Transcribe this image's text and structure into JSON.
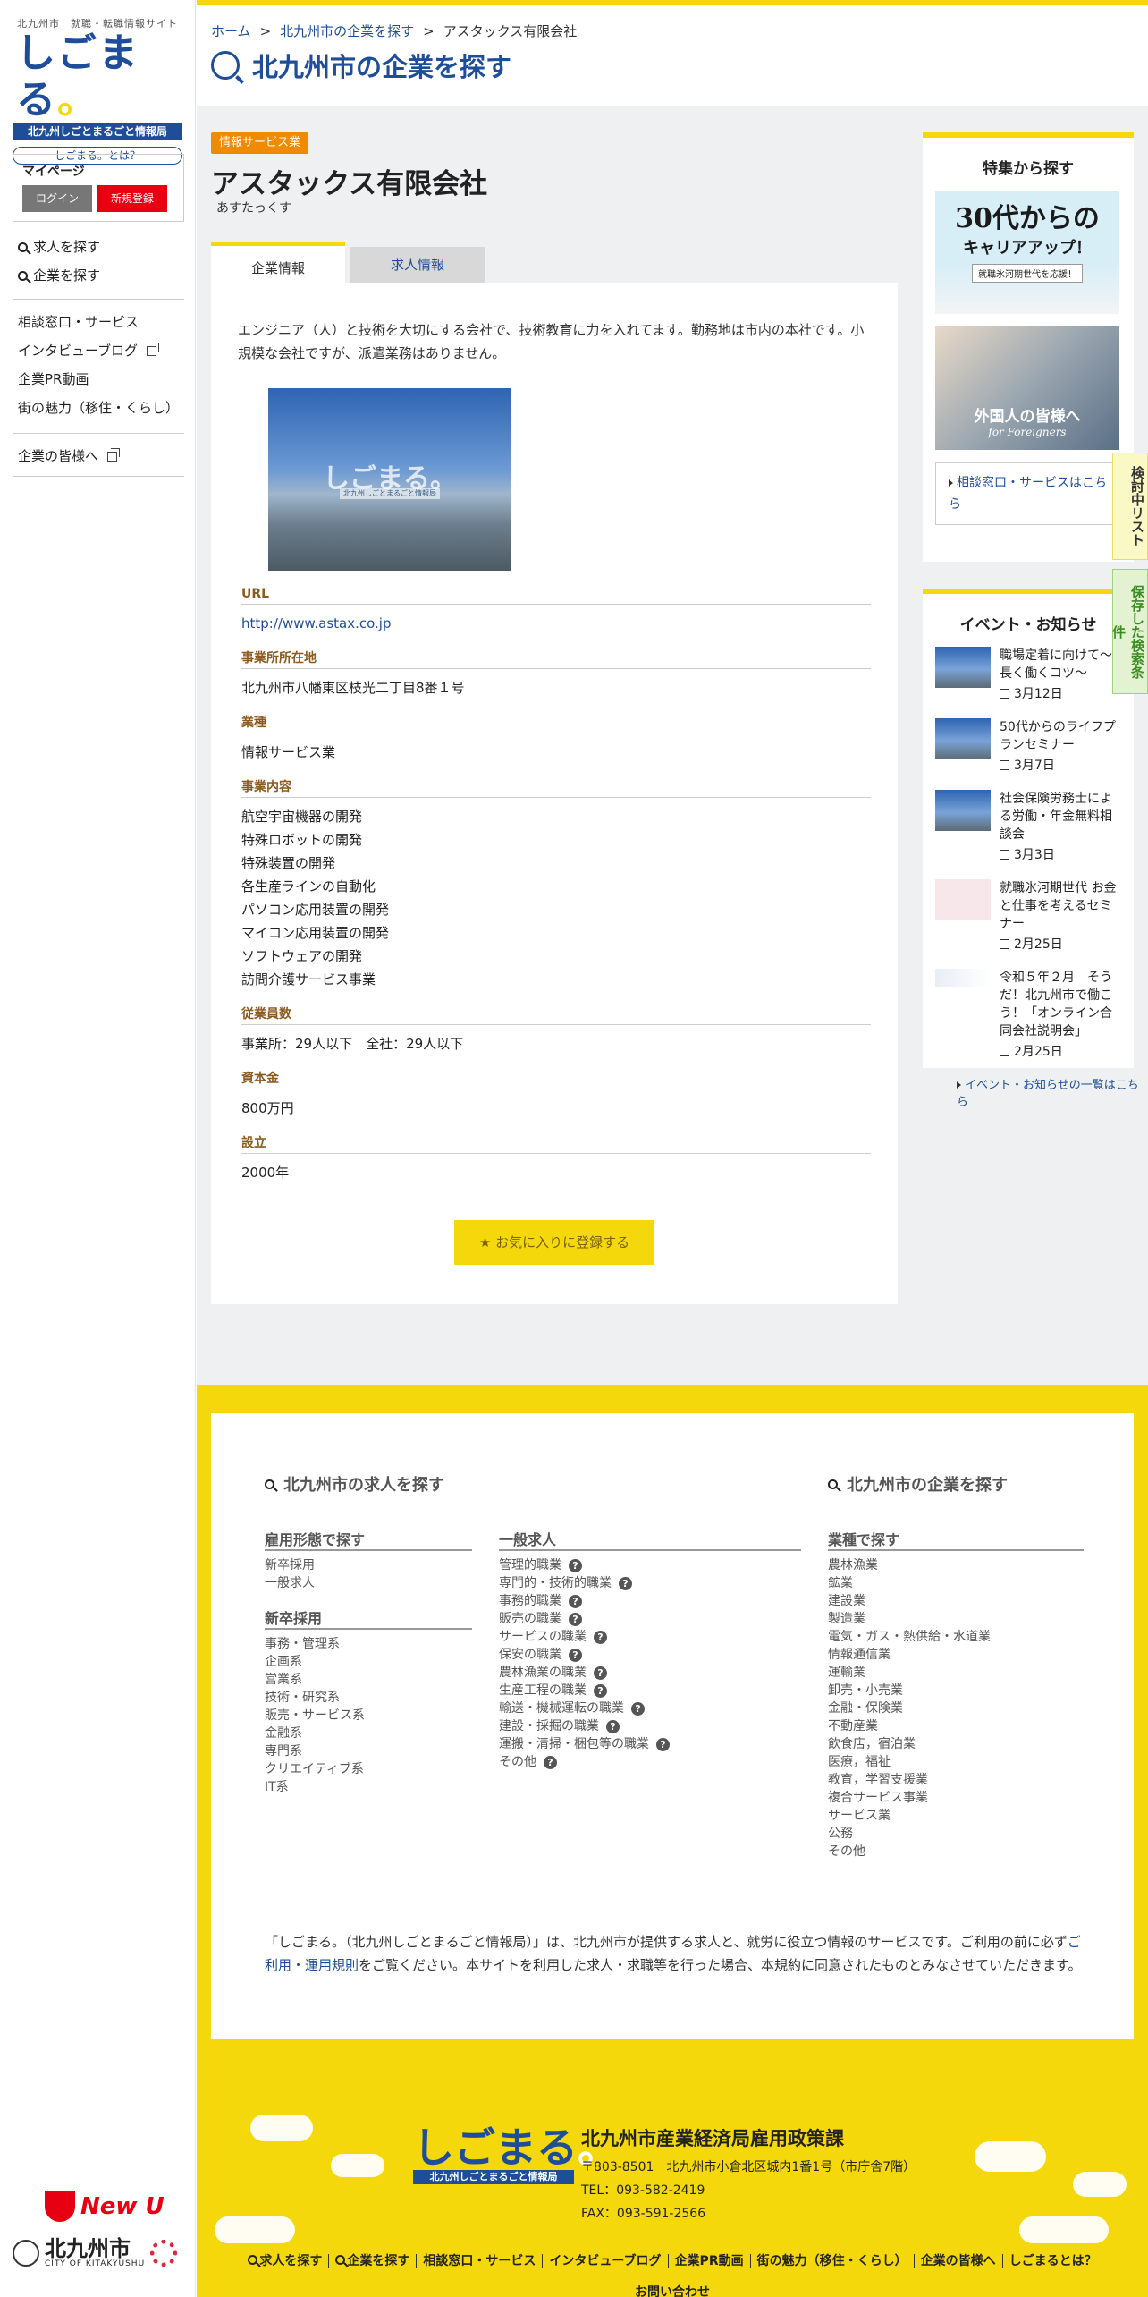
{
  "site": {
    "tagline": "北九州市　就職・転職情報サイト",
    "logo_text": "しごまる",
    "logo_band": "北九州しごとまるごと情報局",
    "what_link": "しごまる。とは？"
  },
  "mypage": {
    "title": "マイページ",
    "login": "ログイン",
    "register": "新規登録"
  },
  "sidebar": {
    "search_items": [
      "求人を探す",
      "企業を探す"
    ],
    "info_items": [
      "相談窓口・サービス",
      "インタビューブログ",
      "企業PR動画",
      "街の魅力（移住・くらし）"
    ],
    "corporate": "企業の皆様へ",
    "newu": "New U",
    "city_name": "北九州市",
    "city_sub": "CITY OF KITAKYUSHU"
  },
  "breadcrumb": {
    "home": "ホーム",
    "search": "北九州市の企業を探す",
    "current": "アスタックス有限会社"
  },
  "page_title": "北九州市の企業を探す",
  "company": {
    "category": "情報サービス業",
    "name": "アスタックス有限会社",
    "kana": "あすたっくす",
    "tabs": [
      "企業情報",
      "求人情報"
    ],
    "intro": "エンジニア（人）と技術を大切にする会社で、技術教育に力を入れてます。勤務地は市内の本社です。小規模な会社ですが、派遣業務はありません。",
    "photo_watermark": "しごまる。",
    "photo_watermark_sub": "北九州しごとまるごと情報局",
    "fields": {
      "url_label": "URL",
      "url": "http://www.astax.co.jp",
      "address_label": "事業所所在地",
      "address": "北九州市八幡東区枝光二丁目8番１号",
      "industry_label": "業種",
      "industry": "情報サービス業",
      "business_label": "事業内容",
      "business": [
        "航空宇宙機器の開発",
        "特殊ロボットの開発",
        "特殊装置の開発",
        "各生産ラインの自動化",
        "パソコン応用装置の開発",
        "マイコン応用装置の開発",
        "ソフトウェアの開発",
        "訪問介護サービス事業"
      ],
      "employees_label": "従業員数",
      "employees": "事業所：29人以下　全社：29人以下",
      "capital_label": "資本金",
      "capital": "800万円",
      "founded_label": "設立",
      "founded": "2000年"
    },
    "favorite_button": "お気に入りに登録する"
  },
  "right": {
    "feature_title": "特集から探す",
    "banner1": {
      "line1": "30代からの",
      "line2": "キャリアアップ！",
      "line3": "就職氷河期世代を応援！"
    },
    "banner2": {
      "line1": "外国人の皆様へ",
      "line2": "for Foreigners"
    },
    "consult_link": "相談窓口・サービスはこちら",
    "events_title": "イベント・お知らせ",
    "events": [
      {
        "title": "職場定着に向けて〜長く働くコツ〜",
        "date": "3月12日"
      },
      {
        "title": "50代からのライフプランセミナー",
        "date": "3月7日"
      },
      {
        "title": "社会保険労務士による労働・年金無料相談会",
        "date": "3月3日"
      },
      {
        "title": "就職氷河期世代 お金と仕事を考えるセミナー",
        "date": "2月25日"
      },
      {
        "title": "令和５年２月　そうだ！北九州市で働こう！「オンライン合同会社説明会」",
        "date": "2月25日"
      }
    ],
    "events_more": "イベント・お知らせの一覧はこちら"
  },
  "side_tabs": {
    "review": "検討中リスト",
    "saved": "保存した検索条件"
  },
  "footer": {
    "jobs_heading": "北九州市の求人を探す",
    "companies_heading": "北九州市の企業を探す",
    "employment_type_heading": "雇用形態で探す",
    "employment_types": [
      "新卒採用",
      "一般求人"
    ],
    "new_grad_heading": "新卒採用",
    "new_grad_items": [
      "事務・管理系",
      "企画系",
      "営業系",
      "技術・研究系",
      "販売・サービス系",
      "金融系",
      "専門系",
      "クリエイティブ系",
      "IT系"
    ],
    "general_heading": "一般求人",
    "general_items": [
      "管理的職業",
      "専門的・技術的職業",
      "事務的職業",
      "販売の職業",
      "サービスの職業",
      "保安の職業",
      "農林漁業の職業",
      "生産工程の職業",
      "輸送・機械運転の職業",
      "建設・採掘の職業",
      "運搬・清掃・梱包等の職業",
      "その他"
    ],
    "industry_heading": "業種で探す",
    "industry_items": [
      "農林漁業",
      "鉱業",
      "建設業",
      "製造業",
      "電気・ガス・熱供給・水道業",
      "情報通信業",
      "運輸業",
      "卸売・小売業",
      "金融・保険業",
      "不動産業",
      "飲食店，宿泊業",
      "医療，福祉",
      "教育，学習支援業",
      "複合サービス事業",
      "サービス業",
      "公務",
      "その他"
    ],
    "note_before": "「しごまる。（北九州しごとまるごと情報局）」は、北九州市が提供する求人と、就労に役立つ情報のサービスです。ご利用の前に必ず",
    "note_link": "ご利用・運用規則",
    "note_after": "をご覧ください。本サイトを利用した求人・求職等を行った場合、本規約に同意されたものとみなさせていただきます。",
    "org_name": "北九州市産業経済局雇用政策課",
    "address": "〒803-8501　北九州市小倉北区城内1番1号（市庁舎7階）",
    "tel": "TEL：093-582-2419",
    "fax": "FAX：093-591-2566",
    "nav": [
      "求人を探す",
      "企業を探す",
      "相談窓口・サービス",
      "インタビューブログ",
      "企業PR動画",
      "街の魅力（移住・くらし）",
      "企業の皆様へ",
      "しごまるとは？"
    ],
    "contact": "お問い合わせ"
  },
  "colors": {
    "brand_blue": "#1e4e9a",
    "brand_yellow": "#f5d80b",
    "category_orange": "#f08a00",
    "register_red": "#e60012"
  }
}
